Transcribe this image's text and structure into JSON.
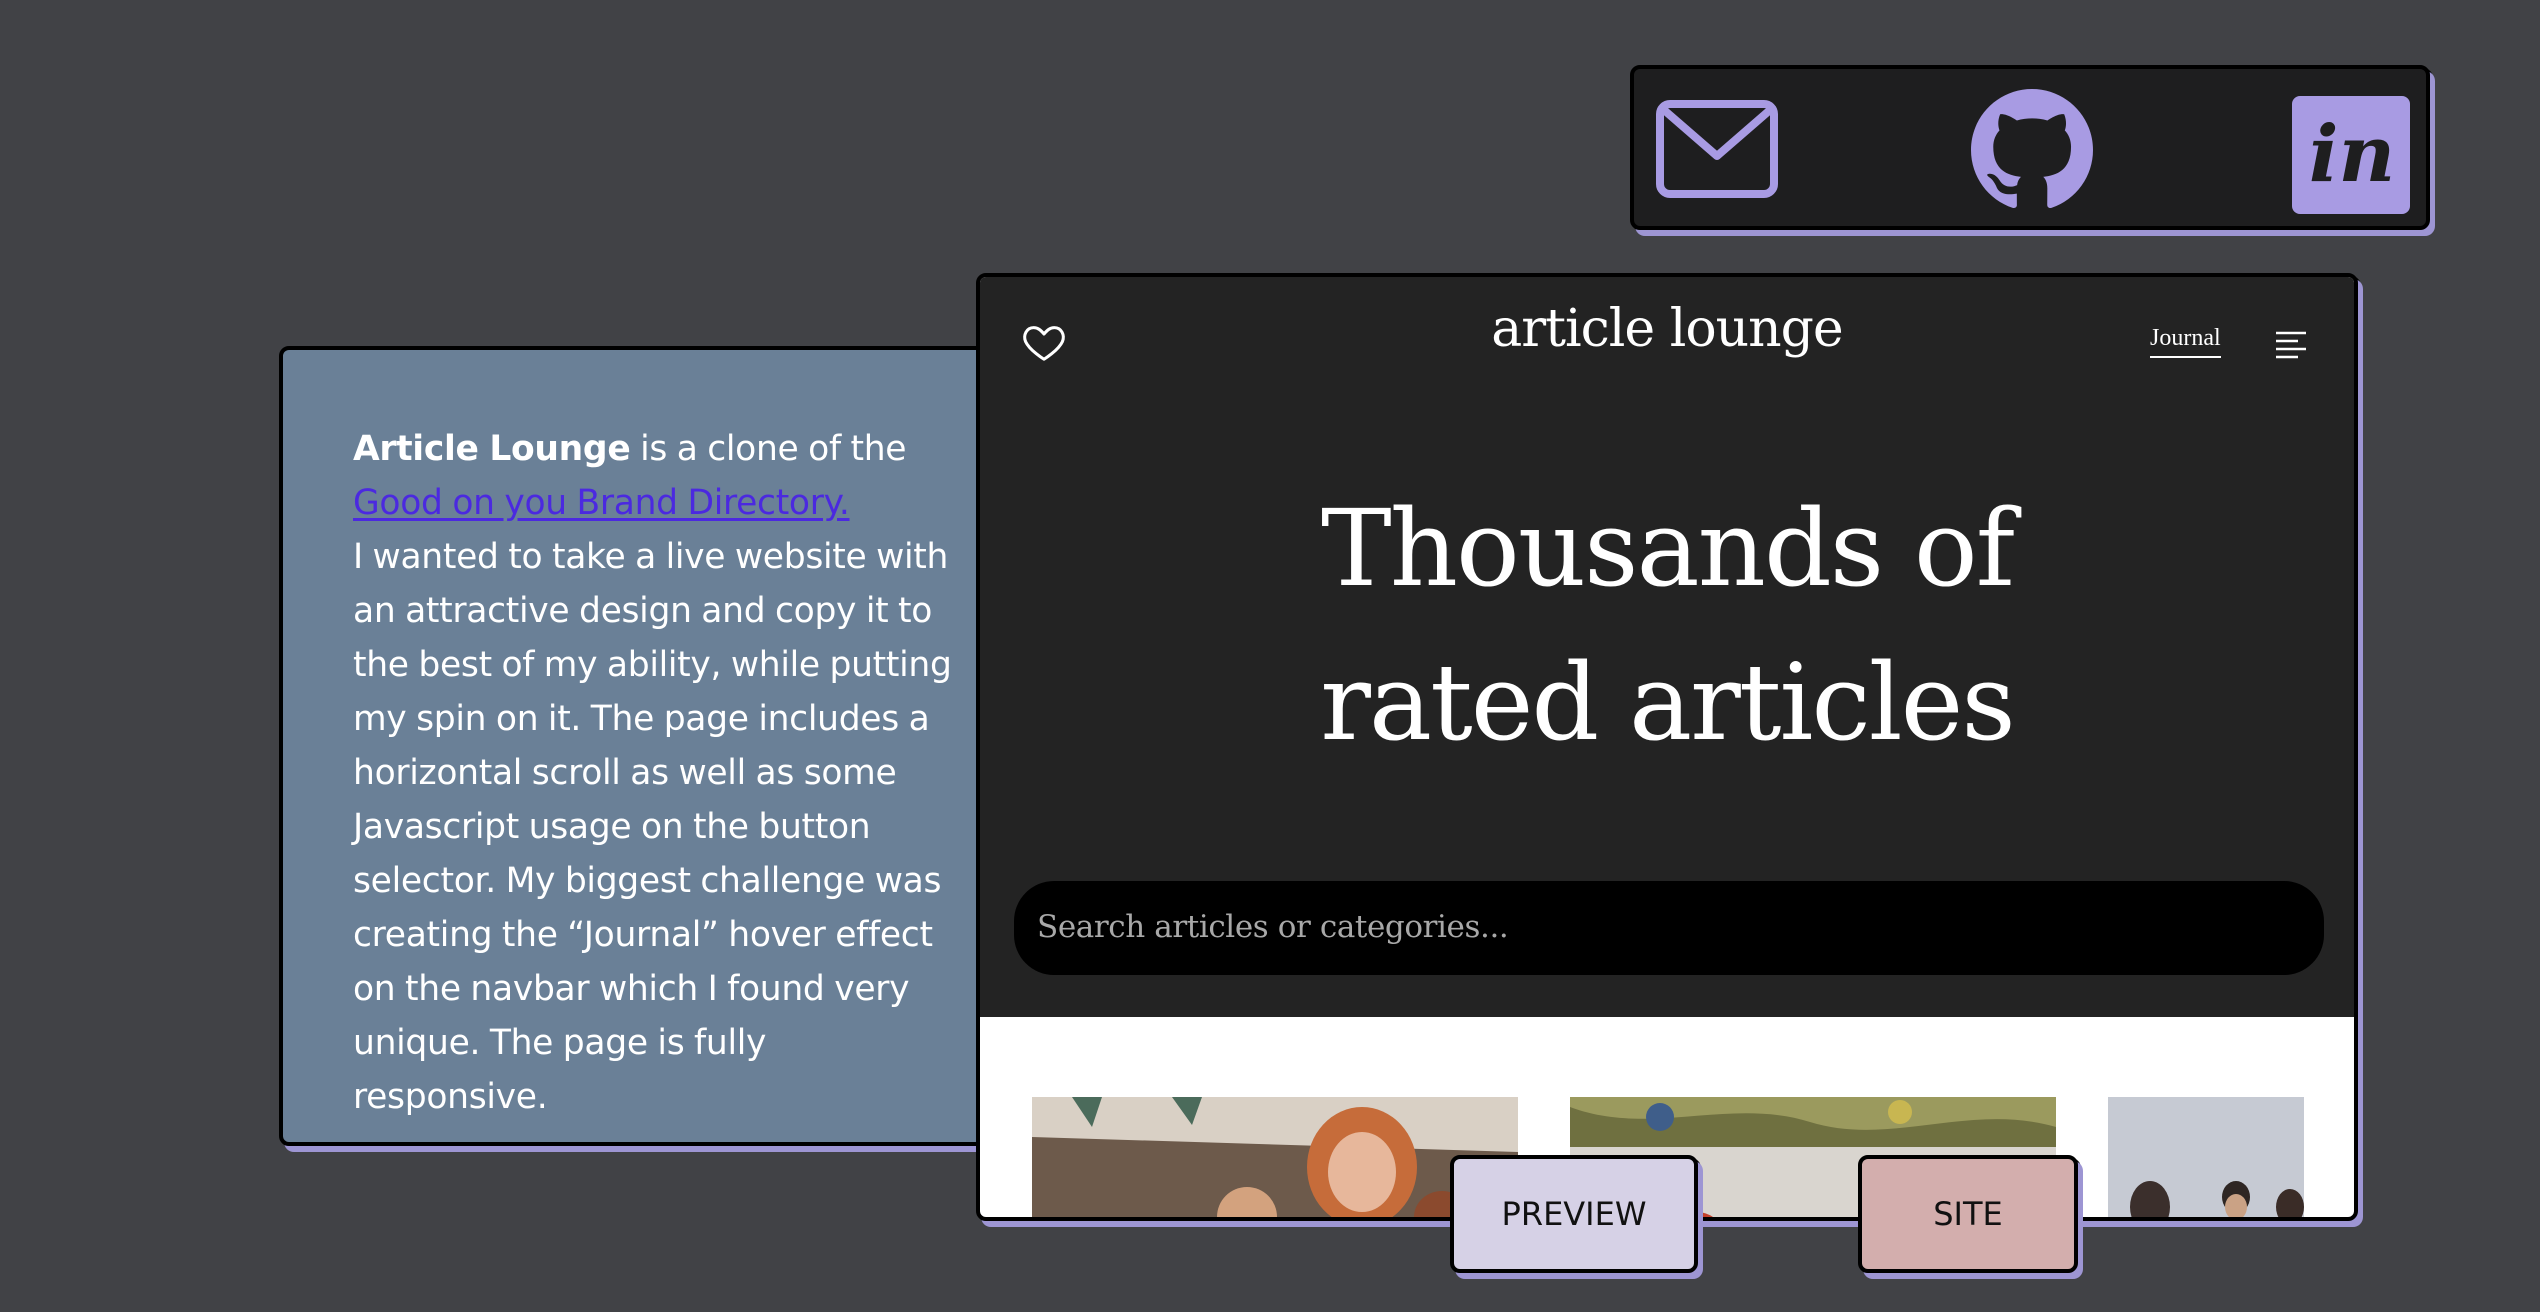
{
  "social": {
    "mail_icon": "mail-icon",
    "github_icon": "github-icon",
    "invision_icon": "invision-icon",
    "invision_text": "in",
    "icon_color": "#a89be3"
  },
  "description": {
    "brand": "Article Lounge",
    "intro": " is a clone of the",
    "link_text": "Good on you Brand Directory.",
    "body": "I wanted to take a live website with an attractive design and copy it to the best of my ability, while putting my spin on it. The page includes a horizontal scroll as well as some Javascript usage on the button selector. My biggest challenge was creating the “Journal” hover effect on the navbar which I found very unique. The page is fully responsive."
  },
  "preview": {
    "site_title": "article lounge",
    "nav_link": "Journal",
    "heart_icon": "heart-icon",
    "menu_icon": "hamburger-menu-icon",
    "hero_line1": "Thousands of",
    "hero_line2": "rated articles",
    "search_placeholder": "Search articles or categories..."
  },
  "buttons": {
    "preview_label": "PREVIEW",
    "site_label": "SITE"
  },
  "colors": {
    "background": "#414246",
    "card_bg": "#6a8097",
    "accent_shadow": "#9d95d3",
    "link": "#4b29e0",
    "preview_button": "#d6d1e6",
    "site_button": "#d3aead"
  }
}
